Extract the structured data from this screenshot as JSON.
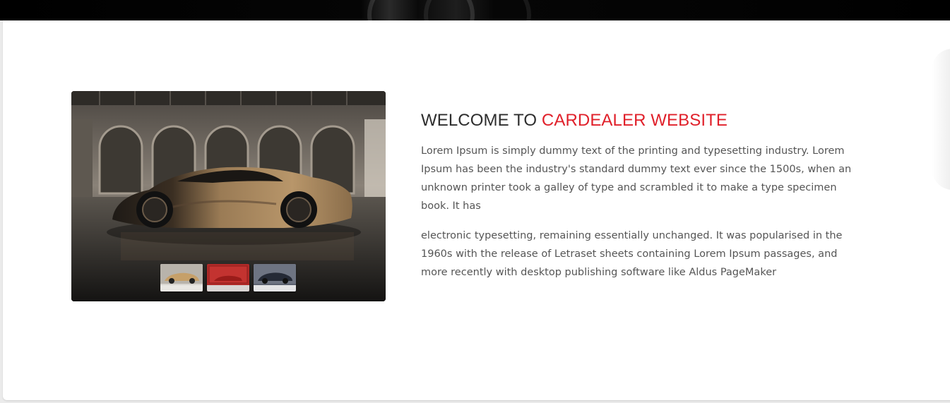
{
  "welcome": {
    "heading_prefix": "WELCOME TO",
    "heading_accent": "CARDEALER WEBSITE",
    "paragraph1": "Lorem Ipsum is simply dummy text of the printing and typesetting industry. Lorem Ipsum has been the industry's standard dummy text ever since the 1500s, when an unknown printer took a galley of type and scrambled it to make a type specimen book. It has",
    "paragraph2": "electronic typesetting, remaining essentially unchanged. It was popularised in the 1960s with the release of Letraset sheets containing Lorem Ipsum passages, and more recently with desktop publishing software like Aldus PageMaker"
  },
  "gallery": {
    "main_image": "car-showroom-photo",
    "thumbnails": [
      "car-thumb-gold",
      "car-thumb-red",
      "car-thumb-dark"
    ]
  },
  "colors": {
    "accent": "#e0202a",
    "heading": "#2d2d2d",
    "body_text": "#555555",
    "banner": "#000000"
  }
}
